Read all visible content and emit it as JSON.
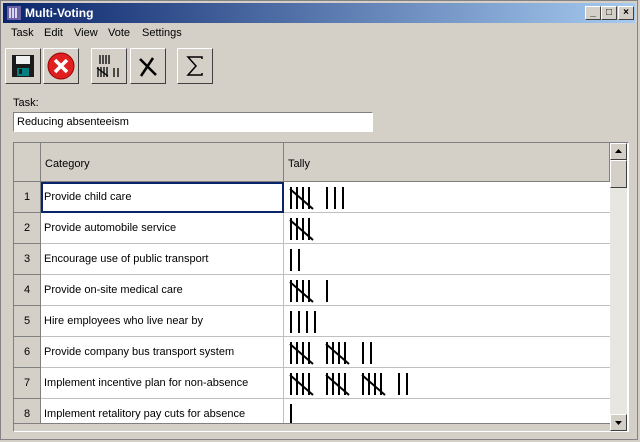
{
  "window": {
    "title": "Multi-Voting"
  },
  "menu": [
    "Task",
    "Edit",
    "View",
    "Vote",
    "Settings"
  ],
  "toolbar": [
    {
      "name": "save-button",
      "icon": "floppy-disk-icon"
    },
    {
      "name": "cancel-button",
      "icon": "red-x-icon"
    },
    {
      "name": "tally-button",
      "icon": "tally-marks-icon"
    },
    {
      "name": "clear-vote-button",
      "icon": "remove-mark-icon"
    },
    {
      "name": "sum-button",
      "icon": "sigma-icon"
    }
  ],
  "task": {
    "label": "Task:",
    "value": "Reducing absenteeism"
  },
  "grid": {
    "columns": [
      "Category",
      "Tally"
    ],
    "rows": [
      {
        "num": "1",
        "category": "Provide child care",
        "tally": 8
      },
      {
        "num": "2",
        "category": "Provide automobile service",
        "tally": 5
      },
      {
        "num": "3",
        "category": "Encourage use of public transport",
        "tally": 2
      },
      {
        "num": "4",
        "category": "Provide on-site medical care",
        "tally": 6
      },
      {
        "num": "5",
        "category": "Hire employees who live near by",
        "tally": 4
      },
      {
        "num": "6",
        "category": "Provide company bus transport system",
        "tally": 12
      },
      {
        "num": "7",
        "category": "Implement incentive plan for non-absence",
        "tally": 17
      },
      {
        "num": "8",
        "category": "Implement retalitory pay cuts for absence",
        "tally": 1
      }
    ],
    "selected_row": 0
  }
}
